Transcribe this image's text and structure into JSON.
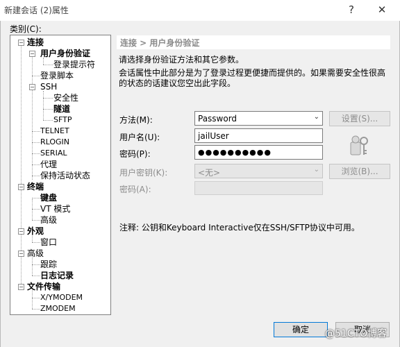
{
  "window": {
    "title": "新建会话 (2)属性",
    "help_glyph": "?",
    "close_glyph": "✕"
  },
  "category_label": "类别(C):",
  "tree": {
    "connection": "连接",
    "user_auth": "用户身份验证",
    "login_prompts": "登录提示符",
    "login_script": "登录脚本",
    "ssh": "SSH",
    "security": "安全性",
    "tunnel": "隧道",
    "sftp": "SFTP",
    "telnet": "TELNET",
    "rlogin": "RLOGIN",
    "serial": "SERIAL",
    "proxy": "代理",
    "keepalive": "保持活动状态",
    "terminal": "终端",
    "keyboard": "键盘",
    "vt_mode": "VT 模式",
    "advanced_term": "高级",
    "appearance": "外观",
    "window": "窗口",
    "advanced": "高级",
    "trace": "跟踪",
    "log": "日志记录",
    "file_transfer": "文件传输",
    "xymodem": "X/YMODEM",
    "zmodem": "ZMODEM"
  },
  "panel": {
    "breadcrumb": "连接 > 用户身份验证",
    "desc1": "请选择身份验证方法和其它参数。",
    "desc2": "会话属性中此部分是为了登录过程更便捷而提供的。如果需要安全性很高",
    "desc3": "的状态的话建议您空出此字段。",
    "method_label": "方法(M):",
    "method_value": "Password",
    "settings_btn": "设置(S)...",
    "username_label": "用户名(U):",
    "username_value": "jailUser",
    "password_label": "密码(P):",
    "password_value": "●●●●●●●●●●",
    "userkey_label": "用户密钥(K):",
    "userkey_value": "<无>",
    "browse_btn": "浏览(B)...",
    "passphrase_label": "密码(A):",
    "passphrase_value": "",
    "note": "注释: 公钥和Keyboard Interactive仅在SSH/SFTP协议中可用。"
  },
  "footer": {
    "ok_btn": "确定",
    "cancel_btn": "取消"
  },
  "watermark": "@51CTO博客",
  "colors": {
    "accent": "#0078d7",
    "tree_bg": "#ffffff",
    "dialog_bg": "#f0f0f0"
  }
}
